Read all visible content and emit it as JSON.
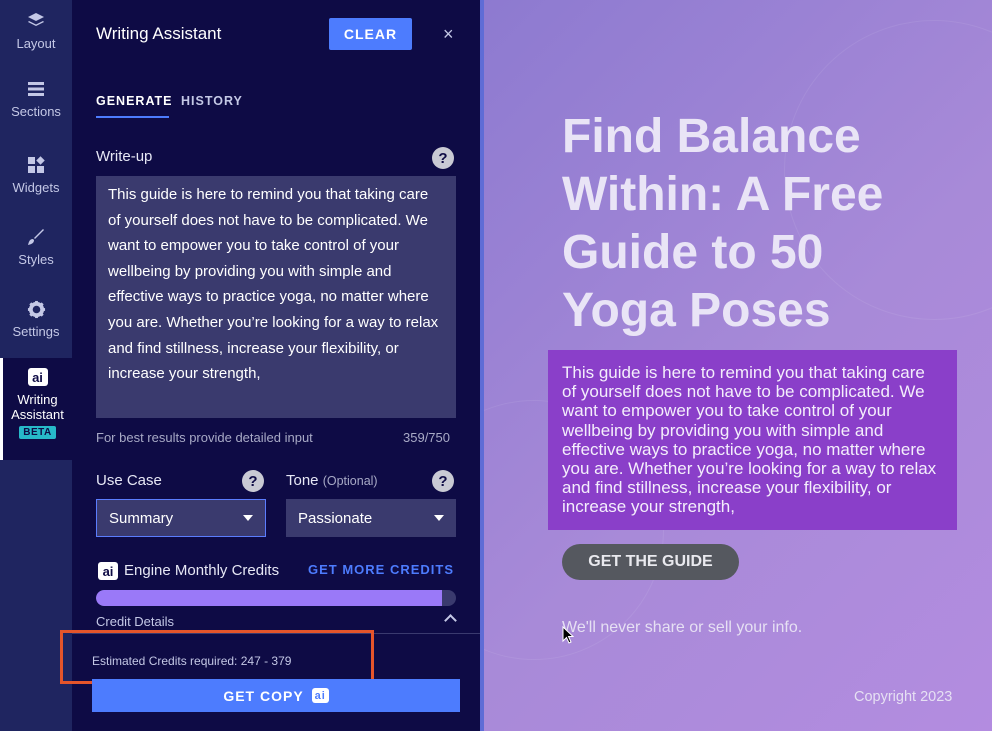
{
  "rail": {
    "items": [
      {
        "label": "Layout",
        "icon": "layers-icon"
      },
      {
        "label": "Sections",
        "icon": "sections-icon"
      },
      {
        "label": "Widgets",
        "icon": "widgets-icon"
      },
      {
        "label": "Styles",
        "icon": "brush-icon"
      },
      {
        "label": "Settings",
        "icon": "gear-icon"
      },
      {
        "label_line1": "Writing",
        "label_line2": "Assistant",
        "badge": "ai",
        "beta": "BETA",
        "icon": "ai-icon"
      }
    ]
  },
  "panel": {
    "title": "Writing Assistant",
    "clear_label": "CLEAR",
    "close_glyph": "×",
    "tabs": [
      {
        "label": "GENERATE",
        "active": true
      },
      {
        "label": "HISTORY",
        "active": false
      }
    ],
    "writeup": {
      "label": "Write-up",
      "help_glyph": "?",
      "value": "This guide is here to remind you that taking care of yourself does not have to be complicated. We want to empower you to take control of your wellbeing by providing you with simple and effective ways to practice yoga, no matter where you are. Whether you’re looking for a way to relax and find stillness, increase your flexibility, or increase your strength,",
      "hint": "For best results provide detailed input",
      "count": "359/750"
    },
    "use_case": {
      "label": "Use Case",
      "help_glyph": "?",
      "value": "Summary"
    },
    "tone": {
      "label": "Tone",
      "optional": "(Optional)",
      "help_glyph": "?",
      "value": "Passionate"
    },
    "credits": {
      "badge": "ai",
      "title": "Engine Monthly Credits",
      "get_more": "GET MORE CREDITS",
      "used_fraction": 0.96,
      "details_label": "Credit Details"
    },
    "estimate": "Estimated Credits required: 247 - 379",
    "get_copy_label": "GET COPY",
    "get_copy_badge": "ai"
  },
  "preview": {
    "headline": "Find Balance Within: A Free Guide to 50 Yoga Poses",
    "body": "This guide is here to remind you that taking care of yourself does not have to be complicated. We want to empower you to take control of your wellbeing by providing you with simple and effective ways to practice yoga, no matter where you are. Whether you’re looking for a way to relax and find stillness, increase your flexibility, or increase your strength,",
    "cta": "GET THE GUIDE",
    "privacy": "We'll never share or sell your info.",
    "copyright": "Copyright 2023"
  },
  "colors": {
    "panel_bg": "#0e0b45",
    "rail_bg": "#1f2560",
    "accent": "#4d7cfe",
    "highlight": "#e5552b",
    "preview_box": "#8a3fc9"
  }
}
